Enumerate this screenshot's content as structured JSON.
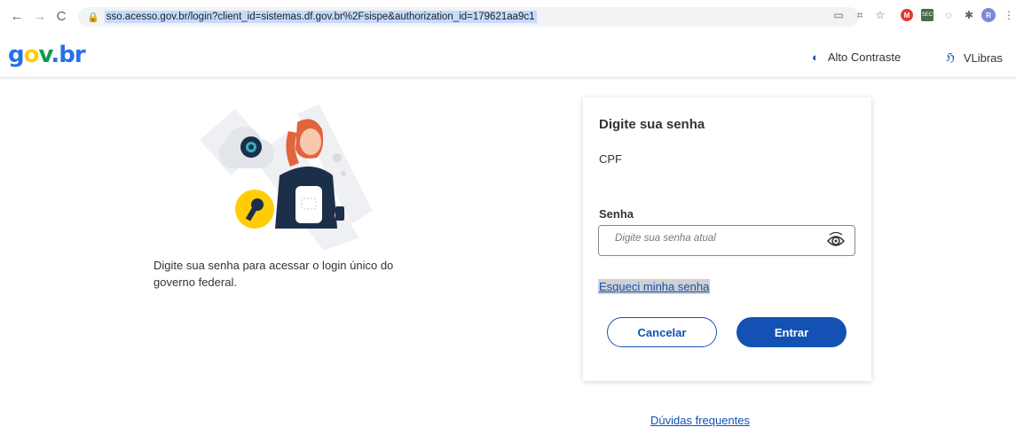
{
  "browser": {
    "url": "sso.acesso.gov.br/login?client_id=sistemas.df.gov.br%2Fsispe&authorization_id=179621aa9c1",
    "profile_initial": "R",
    "ext_labels": [
      "M",
      "SEC"
    ]
  },
  "header": {
    "logo_parts": [
      "g",
      "o",
      "v",
      ".",
      "b",
      "r"
    ],
    "contrast_label": "Alto Contraste",
    "vlibras_label": "VLibras"
  },
  "intro": {
    "text": "Digite sua senha para acessar o login único do governo federal."
  },
  "card": {
    "title": "Digite sua senha",
    "cpf_label": "CPF",
    "password_label": "Senha",
    "password_placeholder": "Digite sua senha atual",
    "forgot_link": "Esqueci minha senha",
    "cancel_label": "Cancelar",
    "enter_label": "Entrar"
  },
  "footer": {
    "faq_link": "Dúvidas frequentes"
  },
  "colors": {
    "primary": "#1351b4",
    "logo_blue": "#2670e8",
    "logo_yellow": "#ffcd07",
    "logo_green": "#0c9b4f"
  }
}
